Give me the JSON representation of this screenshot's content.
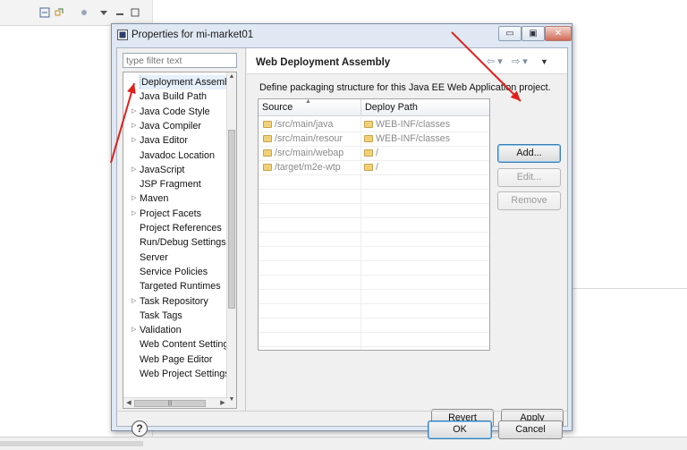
{
  "dialog": {
    "title": "Properties for mi-market01",
    "filter_placeholder": "type filter text",
    "tree_items": [
      {
        "label": "Deployment Assembly",
        "expandable": false,
        "selected": true
      },
      {
        "label": "Java Build Path",
        "expandable": false
      },
      {
        "label": "Java Code Style",
        "expandable": true
      },
      {
        "label": "Java Compiler",
        "expandable": true
      },
      {
        "label": "Java Editor",
        "expandable": true
      },
      {
        "label": "Javadoc Location",
        "expandable": false
      },
      {
        "label": "JavaScript",
        "expandable": true
      },
      {
        "label": "JSP Fragment",
        "expandable": false
      },
      {
        "label": "Maven",
        "expandable": true
      },
      {
        "label": "Project Facets",
        "expandable": true
      },
      {
        "label": "Project References",
        "expandable": false
      },
      {
        "label": "Run/Debug Settings",
        "expandable": false
      },
      {
        "label": "Server",
        "expandable": false
      },
      {
        "label": "Service Policies",
        "expandable": false
      },
      {
        "label": "Targeted Runtimes",
        "expandable": false
      },
      {
        "label": "Task Repository",
        "expandable": true
      },
      {
        "label": "Task Tags",
        "expandable": false
      },
      {
        "label": "Validation",
        "expandable": true
      },
      {
        "label": "Web Content Settings",
        "expandable": false
      },
      {
        "label": "Web Page Editor",
        "expandable": false
      },
      {
        "label": "Web Project Settings",
        "expandable": false
      }
    ],
    "page_title": "Web Deployment Assembly",
    "description": "Define packaging structure for this Java EE Web Application project.",
    "table": {
      "headers": {
        "source": "Source",
        "deploy_path": "Deploy Path"
      },
      "rows": [
        {
          "source": "/src/main/java",
          "deploy": "WEB-INF/classes"
        },
        {
          "source": "/src/main/resour",
          "deploy": "WEB-INF/classes"
        },
        {
          "source": "/src/main/webap",
          "deploy": "/"
        },
        {
          "source": "/target/m2e-wtp",
          "deploy": "/"
        }
      ]
    },
    "buttons": {
      "add": "Add...",
      "edit": "Edit...",
      "remove": "Remove",
      "revert": "Revert",
      "apply": "Apply",
      "ok": "OK",
      "cancel": "Cancel",
      "help": "?"
    },
    "nav": {
      "back": "⇦ ▾",
      "forward": "⇨ ▾",
      "menu": "▼"
    },
    "window_buttons": {
      "minimize": "▭",
      "maximize": "▣",
      "close": "✕"
    }
  },
  "colors": {
    "annotation_arrow": "#e0201a"
  }
}
